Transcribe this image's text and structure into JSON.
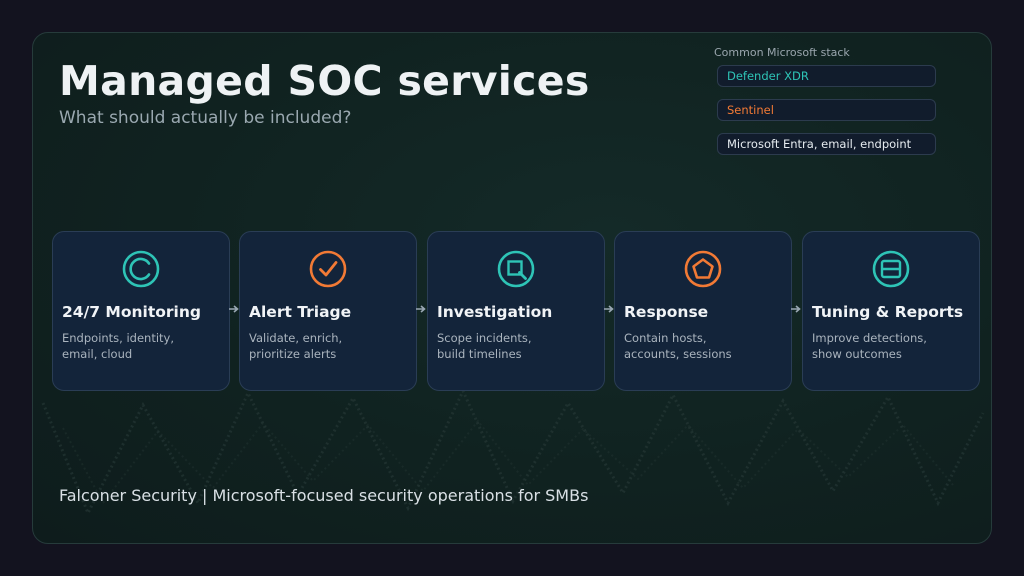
{
  "slide": {
    "title": "Managed SOC services",
    "subtitle": "What should actually be included?",
    "footer": "Falconer Security | Microsoft-focused security operations for SMBs"
  },
  "stack": {
    "label": "Common Microsoft stack",
    "items": [
      {
        "label": "Defender XDR",
        "color": "#2ec4b6"
      },
      {
        "label": "Sentinel",
        "color": "#f27a35"
      },
      {
        "label": "Microsoft Entra, email, endpoint",
        "color": "#e6ecf0"
      }
    ]
  },
  "steps": [
    {
      "title": "24/7 Monitoring",
      "line1": "Endpoints, identity,",
      "line2": "email, cloud",
      "icon": "monitoring-icon",
      "color": "#2ec4b6"
    },
    {
      "title": "Alert Triage",
      "line1": "Validate, enrich,",
      "line2": "prioritize alerts",
      "icon": "check-icon",
      "color": "#f27a35"
    },
    {
      "title": "Investigation",
      "line1": "Scope incidents,",
      "line2": "build timelines",
      "icon": "magnifier-icon",
      "color": "#2ec4b6"
    },
    {
      "title": "Response",
      "line1": "Contain hosts,",
      "line2": "accounts, sessions",
      "icon": "pentagon-icon",
      "color": "#f27a35"
    },
    {
      "title": "Tuning & Reports",
      "line1": "Improve detections,",
      "line2": "show outcomes",
      "icon": "report-icon",
      "color": "#2ec4b6"
    }
  ],
  "colors": {
    "accent_teal": "#2ec4b6",
    "accent_orange": "#f27a35",
    "card_background": "#13243a"
  }
}
